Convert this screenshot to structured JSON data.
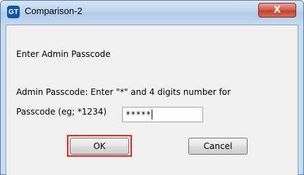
{
  "window": {
    "title": "Comparison-2",
    "app_icon_text": "GT",
    "close_glyph": "X"
  },
  "dialog": {
    "heading": "Enter Admin Passcode",
    "description_line1": "Admin Passcode: Enter \"*\" and 4 digits number for",
    "description_line2": "Passcode (eg; *1234)",
    "passcode_value": "*****",
    "ok_label": "OK",
    "cancel_label": "Cancel"
  },
  "colors": {
    "highlight": "#e8241d",
    "titlebar": "#bcd3ec",
    "close_button": "#c2422d"
  }
}
